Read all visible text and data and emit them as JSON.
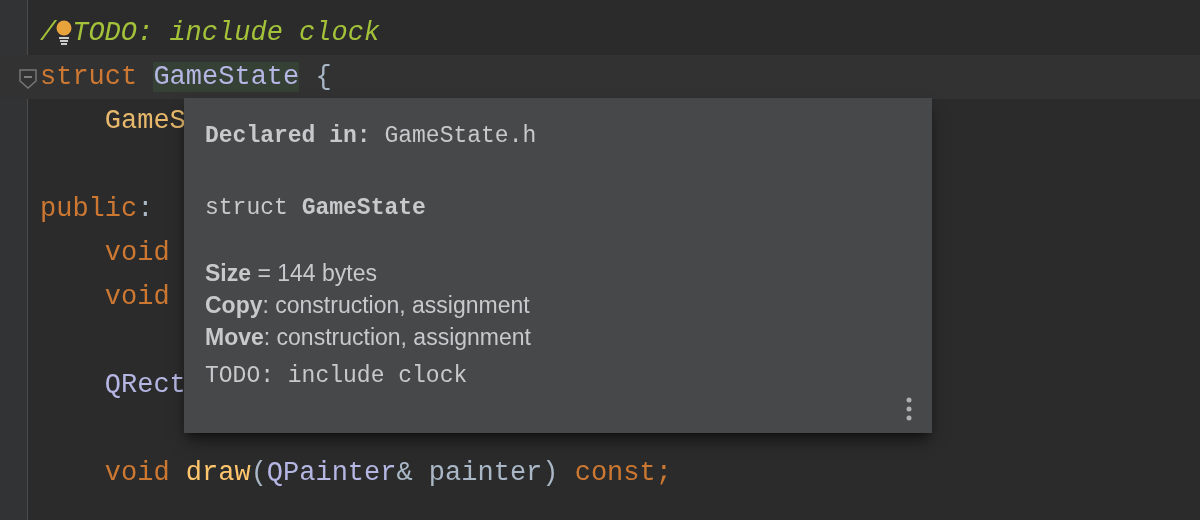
{
  "editor": {
    "lines": [
      {
        "current": false,
        "fold": false,
        "tokens": [
          {
            "text": "/",
            "kind": "comment"
          },
          {
            "kind": "bulb"
          },
          {
            "text": "TODO: include clock",
            "kind": "comment"
          }
        ]
      },
      {
        "current": true,
        "fold": true,
        "tokens": [
          {
            "text": "struct ",
            "kind": "keyword"
          },
          {
            "text": "GameState",
            "kind": "usage"
          },
          {
            "text": " {",
            "kind": "plain"
          }
        ]
      },
      {
        "current": false,
        "fold": false,
        "tokens": [
          {
            "text": "    GameS",
            "kind": "member"
          }
        ]
      },
      {
        "current": false,
        "fold": false
      },
      {
        "current": false,
        "fold": false,
        "tokens": [
          {
            "text": "public",
            "kind": "keyword"
          },
          {
            "text": ":",
            "kind": "plain"
          }
        ]
      },
      {
        "current": false,
        "fold": false,
        "tokens": [
          {
            "text": "    void",
            "kind": "keyword"
          }
        ]
      },
      {
        "current": false,
        "fold": false,
        "tokens": [
          {
            "text": "    void",
            "kind": "keyword"
          }
        ]
      },
      {
        "current": false,
        "fold": false
      },
      {
        "current": false,
        "fold": false,
        "tokens": [
          {
            "text": "    QRect",
            "kind": "type"
          }
        ]
      },
      {
        "current": false,
        "fold": false
      },
      {
        "current": false,
        "fold": false,
        "tokens": [
          {
            "text": "    void ",
            "kind": "keyword"
          },
          {
            "text": "draw",
            "kind": "function"
          },
          {
            "text": "(",
            "kind": "plain"
          },
          {
            "text": "QPainter",
            "kind": "type"
          },
          {
            "text": "& painter) ",
            "kind": "plain"
          },
          {
            "text": "const;",
            "kind": "keyword"
          }
        ]
      }
    ]
  },
  "popup": {
    "declared_label": "Declared in:",
    "declared_value": "GameState.h",
    "signature": "struct **GameState**",
    "facts": [
      "**Size** = 144 bytes",
      "**Copy**: construction, assignment",
      "**Move**: construction, assignment"
    ],
    "comment": "TODO: include clock"
  }
}
